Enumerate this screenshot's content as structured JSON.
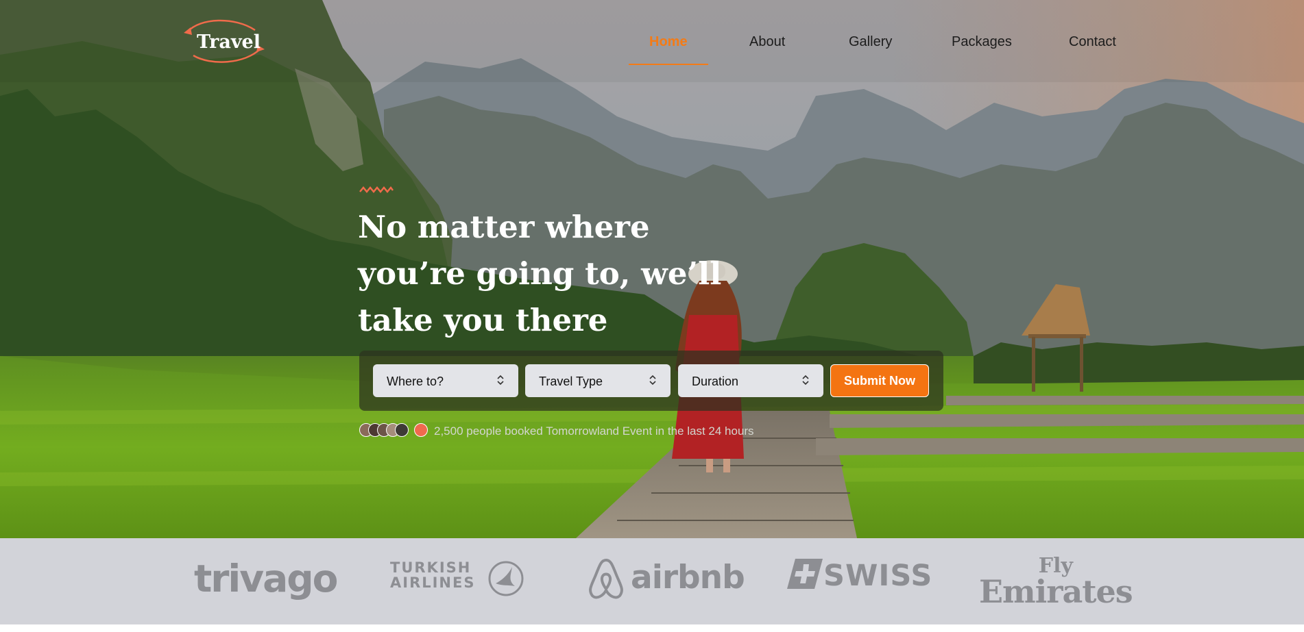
{
  "logo": {
    "text": "Travel",
    "accent_color": "#f06b4b"
  },
  "nav": {
    "items": [
      {
        "label": "Home",
        "active": true
      },
      {
        "label": "About",
        "active": false
      },
      {
        "label": "Gallery",
        "active": false
      },
      {
        "label": "Packages",
        "active": false
      },
      {
        "label": "Contact",
        "active": false
      }
    ],
    "active_color": "#f47b16"
  },
  "hero": {
    "headline_lines": [
      "No matter where",
      "you’re going to, we’ll",
      "take you there"
    ]
  },
  "search": {
    "destination": {
      "value": "Where to?",
      "icon": "chevron-up-down-icon"
    },
    "travel_type": {
      "value": "Travel Type",
      "icon": "chevron-up-down-icon"
    },
    "duration": {
      "value": "Duration",
      "icon": "chevron-up-down-icon"
    },
    "submit_label": "Submit Now",
    "submit_color": "#f47412"
  },
  "social_proof": {
    "text": "2,500 people booked Tomorrowland Event in the last 24 hours",
    "avatar_count": 6
  },
  "brands": {
    "trivago": "trivago",
    "turkish_line1": "TURKISH",
    "turkish_line2": "AIRLINES",
    "airbnb": "airbnb",
    "swiss": "SWISS",
    "emirates_line1": "Fly",
    "emirates_line2": "Emirates"
  }
}
